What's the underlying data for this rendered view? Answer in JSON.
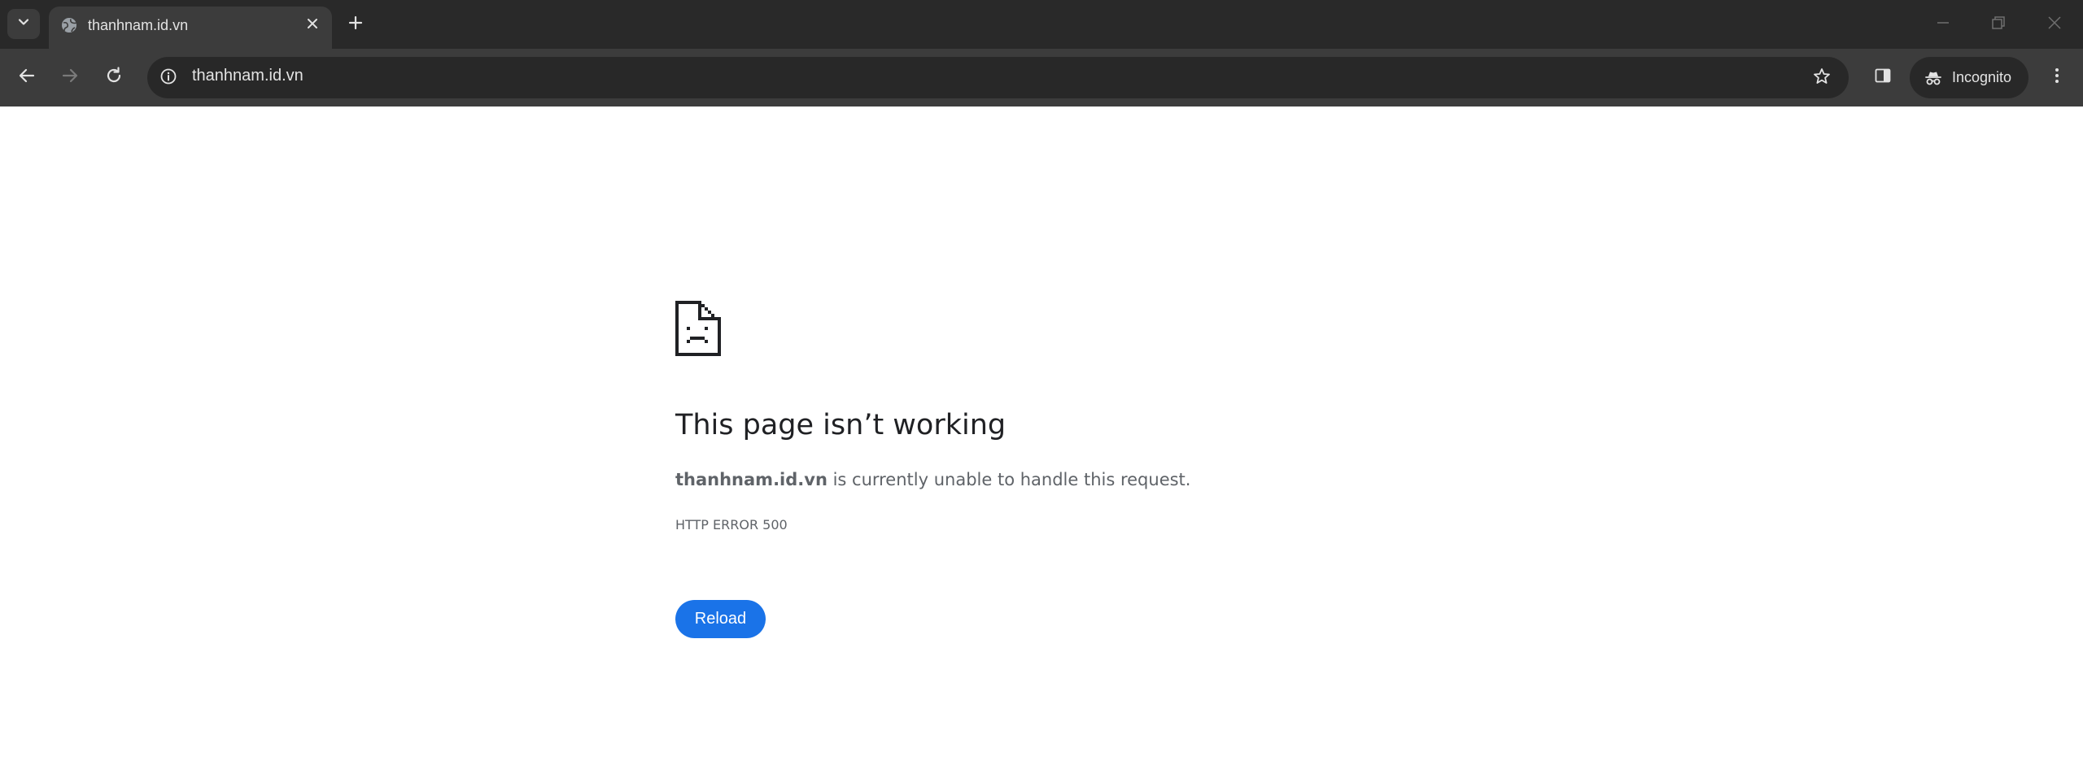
{
  "browser": {
    "tab": {
      "title": "thanhnam.id.vn",
      "favicon": "globe-icon"
    },
    "omnibox": {
      "url": "thanhnam.id.vn"
    },
    "profile": {
      "label": "Incognito"
    },
    "icons": {
      "tab_search": "chevron-down-icon",
      "tab_close": "close-icon",
      "new_tab": "plus-icon",
      "back": "arrow-left-icon",
      "forward": "arrow-right-icon",
      "reload": "refresh-icon",
      "site_info": "info-icon",
      "bookmark": "star-icon",
      "side_panel": "side-panel-icon",
      "incognito": "incognito-icon",
      "menu": "kebab-menu-icon",
      "minimize": "minimize-icon",
      "restore": "restore-icon",
      "close_window": "close-icon"
    },
    "colors": {
      "tabstrip_bg": "#292929",
      "toolbar_bg": "#3c3c3c",
      "omnibox_bg": "#282828",
      "toolbar_text": "#e3e3e3"
    }
  },
  "error_page": {
    "icon": "sad-document-icon",
    "heading": "This page isn’t working",
    "host": "thanhnam.id.vn",
    "message": " is currently unable to handle this request.",
    "error_code": "HTTP ERROR 500",
    "reload_label": "Reload",
    "colors": {
      "heading": "#202124",
      "body_text": "#5f6368",
      "button_bg": "#1a73e8",
      "button_text": "#ffffff"
    }
  }
}
